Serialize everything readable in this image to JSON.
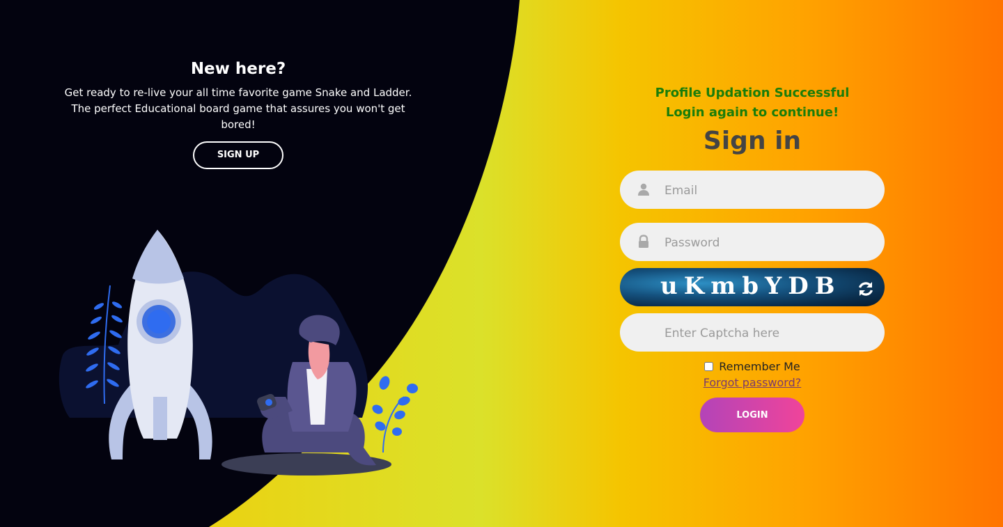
{
  "left": {
    "title": "New here?",
    "description": "Get ready to re-live your all time favorite game Snake and Ladder. The perfect Educational board game that assures you won't get bored!",
    "signup_label": "SIGN UP"
  },
  "right": {
    "success_line1": "Profile Updation Successful",
    "success_line2": "Login again to continue!",
    "title": "Sign in",
    "email_placeholder": "Email",
    "password_placeholder": "Password",
    "captcha_text": "uKmbYDB",
    "captcha_placeholder": "Enter Captcha here",
    "remember_label": "Remember Me",
    "forgot_label": "Forgot password?",
    "login_label": "LOGIN"
  },
  "icons": {
    "email": "user-icon",
    "password": "lock-icon",
    "refresh": "refresh-icon"
  },
  "colors": {
    "success": "#1a7d0a",
    "dark_panel": "#03030f",
    "login_gradient_start": "#b344b8",
    "login_gradient_end": "#f0449a"
  }
}
